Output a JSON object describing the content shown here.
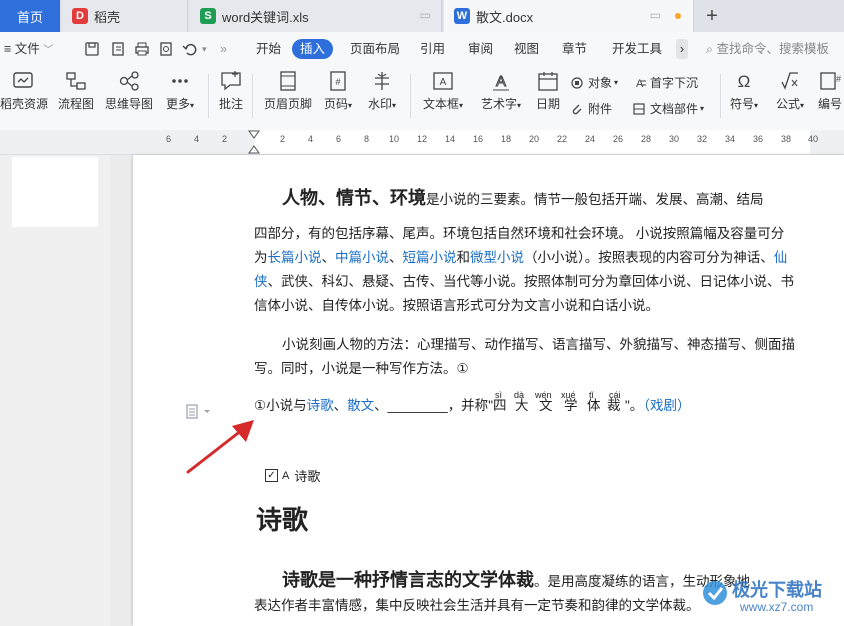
{
  "tabs": {
    "home": "首页",
    "docer": "稻壳",
    "xls": "word关键词.xls",
    "docx": "散文.docx",
    "new_tab": "+"
  },
  "menu": {
    "file": "文件",
    "items": [
      "开始",
      "插入",
      "页面布局",
      "引用",
      "审阅",
      "视图",
      "章节",
      "开发工具"
    ],
    "active_index": 1,
    "search_placeholder": "查找命令、搜索模板"
  },
  "ribbon": {
    "big_buttons": [
      "稻壳资源",
      "流程图",
      "思维导图",
      "更多",
      "批注",
      "页眉页脚",
      "页码",
      "水印",
      "文本框",
      "艺术字",
      "日期",
      "符号",
      "公式",
      "编号"
    ],
    "small_buttons": [
      "对象",
      "附件",
      "首字下沉",
      "文档部件"
    ]
  },
  "ruler": {
    "ticks": [
      "6",
      "4",
      "2",
      "2",
      "4",
      "6",
      "8",
      "10",
      "12",
      "14",
      "16",
      "18",
      "20",
      "22",
      "24",
      "26",
      "28",
      "30",
      "32",
      "34",
      "36",
      "38",
      "40"
    ]
  },
  "doc": {
    "p1": {
      "bold": "人物、情节、环境",
      "t1": "是小说的三要素。情节一般包括开端、发展、高潮、结局",
      "t2": "四部分，有的包括序幕、尾声。环境包括自然环境和社会环境。 小说按照篇幅及容量可分",
      "t3a": "为",
      "l1": "长篇小说",
      "s1": "、",
      "l2": "中篇小说",
      "s2": "、",
      "l3": "短篇小说",
      "t3b": "和",
      "l4": "微型小说",
      "t3c": "（小小说）。按照表现的内容可分为神话、",
      "l5a": "仙",
      "l5b": "侠",
      "t4": "、武侠、科幻、悬疑、古传、当代等小说。按照体制可分为章回体小说、日记体小说、书",
      "t5": "信体小说、自传体小说。按照语言形式可分为文言小说和白话小说。"
    },
    "p2": {
      "l1": "小说刻画人物的方法：心理描写、动作描写、语言描写、外貌描写、神态描写、侧面描",
      "l2": "写。同时，小说是一种写作方法。①"
    },
    "footnote": {
      "mark": "①",
      "t1": "小说与",
      "link1": "诗歌",
      "sep1": "、",
      "link2": "散文",
      "sep2": "、",
      "blank": "________",
      "t2": "，并称",
      "quote_open": "\"",
      "chars": [
        "四",
        "大",
        "文",
        "学",
        "体",
        "裁"
      ],
      "pinyin": [
        "sì",
        "dà",
        "wén",
        "xué",
        "tǐ",
        "cái"
      ],
      "quote_close": "\"。",
      "answer": "（戏剧）"
    },
    "checkbox": {
      "checked": true,
      "letter": "A",
      "label": "诗歌"
    },
    "heading": "诗歌",
    "p3": {
      "bold": "诗歌是一种抒情言志的文学体裁",
      "t1": "。是用高度凝练的语言，生动形象地",
      "t2": "表达作者丰富情感，集中反映社会生活并具有一定节奏和韵律的文学体裁。"
    }
  },
  "watermark": {
    "name": "极光下载站",
    "url": "www.xz7.com"
  },
  "colors": {
    "accent": "#2e6fdb",
    "link": "#1a6fc4",
    "arrow": "#d62a2a"
  }
}
